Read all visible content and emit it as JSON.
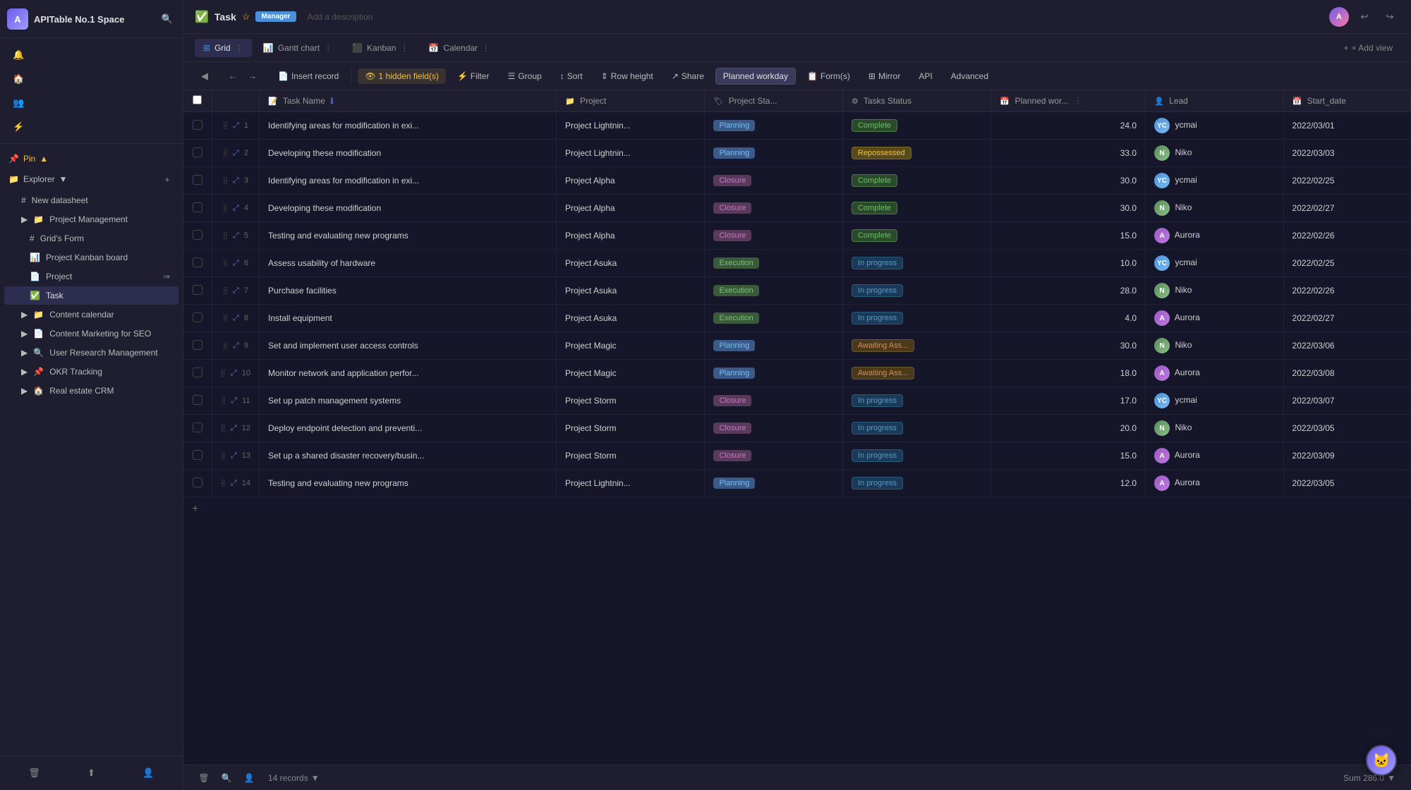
{
  "app": {
    "logo_initials": "A",
    "workspace_title": "APITable No.1 Space",
    "dot_indicator": "●",
    "search_icon": "🔍"
  },
  "sidebar": {
    "pin_label": "Pin",
    "explorer_label": "Explorer",
    "new_datasheet_label": "New datasheet",
    "items": [
      {
        "id": "project-mgmt",
        "label": "Project Management",
        "icon": "📁",
        "indent": 0
      },
      {
        "id": "grids-form",
        "label": "Grid's Form",
        "icon": "📋",
        "indent": 1
      },
      {
        "id": "kanban",
        "label": "Project Kanban board",
        "icon": "📊",
        "indent": 1
      },
      {
        "id": "project",
        "label": "Project",
        "icon": "📄",
        "indent": 1
      },
      {
        "id": "task",
        "label": "Task",
        "icon": "✅",
        "indent": 1,
        "active": true
      },
      {
        "id": "content-cal",
        "label": "Content calendar",
        "icon": "📁",
        "indent": 0
      },
      {
        "id": "content-mkt",
        "label": "Content Marketing for SEO",
        "icon": "📁",
        "indent": 0
      },
      {
        "id": "user-research",
        "label": "User Research Management",
        "icon": "🔍",
        "indent": 0
      },
      {
        "id": "okr",
        "label": "OKR Tracking",
        "icon": "📌",
        "indent": 0
      },
      {
        "id": "real-estate",
        "label": "Real estate CRM",
        "icon": "🏠",
        "indent": 0
      }
    ],
    "bottom_icons": [
      "🗑",
      "↑",
      "👤"
    ]
  },
  "topbar": {
    "task_label": "Task",
    "star_icon": "☆",
    "manager_badge": "Manager",
    "description_placeholder": "Add a description",
    "right_icons": [
      "👤",
      "↩"
    ]
  },
  "view_tabs": [
    {
      "id": "grid",
      "label": "Grid",
      "dot_color": "#4a90d9",
      "active": true
    },
    {
      "id": "gantt",
      "label": "Gantt chart"
    },
    {
      "id": "kanban",
      "label": "Kanban"
    },
    {
      "id": "calendar",
      "label": "Calendar"
    },
    {
      "id": "add-view",
      "label": "+ Add view"
    }
  ],
  "toolbar": {
    "expand_icon": "◀",
    "back_icon": "←",
    "forward_icon": "→",
    "insert_record_label": "Insert record",
    "hidden_fields_label": "1 hidden field(s)",
    "filter_label": "Filter",
    "group_label": "Group",
    "sort_label": "Sort",
    "row_height_label": "Row height",
    "share_label": "Share",
    "planned_workday_tooltip": "Planned workday",
    "form_label": "Form(s)",
    "mirror_label": "Mirror",
    "api_label": "API",
    "advanced_label": "Advanced"
  },
  "columns": [
    {
      "id": "task-name",
      "label": "Task Name",
      "icon": "📝"
    },
    {
      "id": "project",
      "label": "Project",
      "icon": "📁"
    },
    {
      "id": "project-status",
      "label": "Project Sta...",
      "icon": "🏷"
    },
    {
      "id": "tasks-status",
      "label": "Tasks Status",
      "icon": "⚙"
    },
    {
      "id": "planned-workdays",
      "label": "Planned wor...",
      "icon": "📅"
    },
    {
      "id": "lead",
      "label": "Lead",
      "icon": "👤"
    },
    {
      "id": "start-date",
      "label": "Start_date",
      "icon": "📅"
    }
  ],
  "rows": [
    {
      "num": 1,
      "task": "Identifying areas for modification in exi...",
      "project": "Project Lightnin...",
      "proj_status": "Planning",
      "task_status": "Complete",
      "planned": "24.0",
      "lead": "ycmai",
      "lead_type": "ycmai",
      "start_date": "2022/03/01"
    },
    {
      "num": 2,
      "task": "Developing these modification",
      "project": "Project Lightnin...",
      "proj_status": "Planning",
      "task_status": "Repossessed",
      "planned": "33.0",
      "lead": "Niko",
      "lead_type": "niko",
      "start_date": "2022/03/03"
    },
    {
      "num": 3,
      "task": "Identifying areas for modification in exi...",
      "project": "Project Alpha",
      "proj_status": "Closure",
      "task_status": "Complete",
      "planned": "30.0",
      "lead": "ycmai",
      "lead_type": "ycmai",
      "start_date": "2022/02/25"
    },
    {
      "num": 4,
      "task": "Developing these modification",
      "project": "Project Alpha",
      "proj_status": "Closure",
      "task_status": "Complete",
      "planned": "30.0",
      "lead": "Niko",
      "lead_type": "niko",
      "start_date": "2022/02/27"
    },
    {
      "num": 5,
      "task": "Testing and evaluating new programs",
      "project": "Project Alpha",
      "proj_status": "Closure",
      "task_status": "Complete",
      "planned": "15.0",
      "lead": "Aurora",
      "lead_type": "aurora",
      "start_date": "2022/02/26"
    },
    {
      "num": 6,
      "task": "Assess usability of hardware",
      "project": "Project Asuka",
      "proj_status": "Execution",
      "task_status": "In progress",
      "planned": "10.0",
      "lead": "ycmai",
      "lead_type": "ycmai",
      "start_date": "2022/02/25"
    },
    {
      "num": 7,
      "task": "Purchase facilities",
      "project": "Project Asuka",
      "proj_status": "Execution",
      "task_status": "In progress",
      "planned": "28.0",
      "lead": "Niko",
      "lead_type": "niko",
      "start_date": "2022/02/26"
    },
    {
      "num": 8,
      "task": "Install equipment",
      "project": "Project Asuka",
      "proj_status": "Execution",
      "task_status": "In progress",
      "planned": "4.0",
      "lead": "Aurora",
      "lead_type": "aurora",
      "start_date": "2022/02/27"
    },
    {
      "num": 9,
      "task": "Set and implement user access controls",
      "project": "Project Magic",
      "proj_status": "Planning",
      "task_status": "Awaiting Ass...",
      "planned": "30.0",
      "lead": "Niko",
      "lead_type": "niko",
      "start_date": "2022/03/06"
    },
    {
      "num": 10,
      "task": "Monitor network and application perfor...",
      "project": "Project Magic",
      "proj_status": "Planning",
      "task_status": "Awaiting Ass...",
      "planned": "18.0",
      "lead": "Aurora",
      "lead_type": "aurora",
      "start_date": "2022/03/08"
    },
    {
      "num": 11,
      "task": "Set up patch management systems",
      "project": "Project Storm",
      "proj_status": "Closure",
      "task_status": "In progress",
      "planned": "17.0",
      "lead": "ycmai",
      "lead_type": "ycmai",
      "start_date": "2022/03/07"
    },
    {
      "num": 12,
      "task": "Deploy endpoint detection and preventi...",
      "project": "Project Storm",
      "proj_status": "Closure",
      "task_status": "In progress",
      "planned": "20.0",
      "lead": "Niko",
      "lead_type": "niko",
      "start_date": "2022/03/05"
    },
    {
      "num": 13,
      "task": "Set up a shared disaster recovery/busin...",
      "project": "Project Storm",
      "proj_status": "Closure",
      "task_status": "In progress",
      "planned": "15.0",
      "lead": "Aurora",
      "lead_type": "aurora",
      "start_date": "2022/03/09"
    },
    {
      "num": 14,
      "task": "Testing and evaluating new programs",
      "project": "Project Lightnin...",
      "proj_status": "Planning",
      "task_status": "In progress",
      "planned": "12.0",
      "lead": "Aurora",
      "lead_type": "aurora",
      "start_date": "2022/03/05"
    }
  ],
  "bottombar": {
    "records_label": "14 records",
    "sum_label": "Sum 286.0"
  }
}
